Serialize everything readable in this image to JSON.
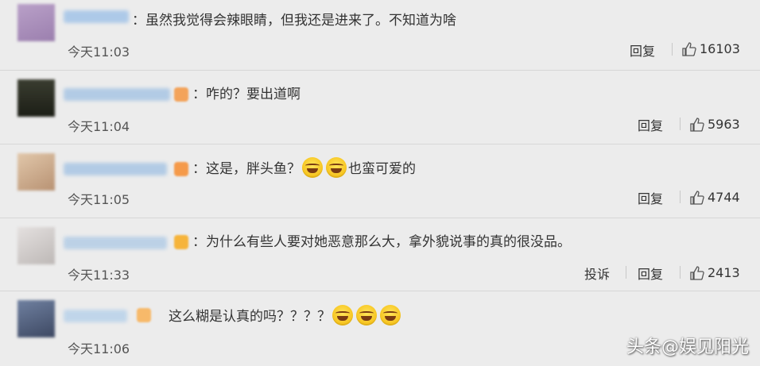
{
  "comments": [
    {
      "text": "：虽然我觉得会辣眼睛，但我还是进来了。不知道为啥",
      "time": "今天11:03",
      "reply": "回复",
      "likes": "16103",
      "colors": {
        "avatar": "#a98fb8",
        "name": "#9fc1e6"
      }
    },
    {
      "text": "：咋的？要出道啊",
      "time": "今天11:04",
      "reply": "回复",
      "likes": "5963",
      "colors": {
        "avatar": "#2a2d22",
        "name": "#a9c6e4",
        "badge": "#f3a35a"
      }
    },
    {
      "text": "：这是，胖头鱼？",
      "text_after": "也蛮可爱的",
      "time": "今天11:05",
      "reply": "回复",
      "likes": "4744",
      "colors": {
        "avatar": "#c9a98c",
        "name": "#a9c6e4",
        "badge": "#f59a4a"
      }
    },
    {
      "text": "：为什么有些人要对她恶意那么大，拿外貌说事的真的很没品。",
      "time": "今天11:33",
      "report": "投诉",
      "reply": "回复",
      "likes": "2413",
      "colors": {
        "avatar": "#d3cfce",
        "name": "#a9c6e4",
        "badge": "#f6b43b"
      }
    },
    {
      "text": "这么糊是认真的吗？？？？",
      "time": "今天11:06",
      "colors": {
        "avatar": "#5a6a88",
        "name": "#b9d2ea",
        "badge": "#f7b96a"
      }
    }
  ],
  "watermark": "头条@娱见阳光",
  "icons": {
    "like": "thumb-up-icon",
    "emoji": "laugh-cry-emoji-icon"
  }
}
